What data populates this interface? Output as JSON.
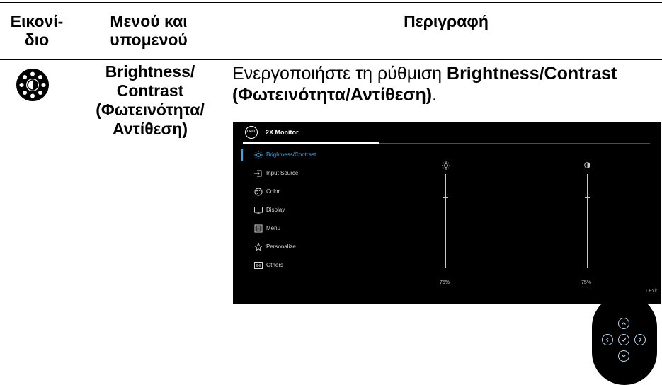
{
  "table": {
    "header": {
      "col1": [
        "Εικονί-",
        "διο"
      ],
      "col2": [
        "Μενού και",
        "υπομενού"
      ],
      "col3": "Περιγραφή"
    },
    "row": {
      "icon": "brightness-sun-icon",
      "menu_name": [
        "Brightness/",
        "Contrast",
        "(Φωτεινότητα/",
        "Αντίθεση)"
      ],
      "description": {
        "prefix": "Ενεργοποιήστε τη ρύθμιση ",
        "bold": "Brightness/Contrast (Φωτεινότητα/Αντίθεση)",
        "suffix": "."
      }
    }
  },
  "osd": {
    "logo": "DELL",
    "title": "2X Monitor",
    "menu": [
      {
        "label": "Brightness/Contrast",
        "icon": "brightness-icon",
        "active": true
      },
      {
        "label": "Input Source",
        "icon": "input-source-icon"
      },
      {
        "label": "Color",
        "icon": "color-palette-icon"
      },
      {
        "label": "Display",
        "icon": "display-icon"
      },
      {
        "label": "Menu",
        "icon": "menu-icon"
      },
      {
        "label": "Personalize",
        "icon": "star-icon"
      },
      {
        "label": "Others",
        "icon": "others-icon"
      }
    ],
    "brightness": {
      "icon": "sun-icon",
      "value_label": "75%",
      "level": 0.75
    },
    "contrast": {
      "icon": "contrast-icon",
      "value_label": "75%",
      "level": 0.75
    },
    "exit_label": "Exit"
  },
  "joystick": {
    "buttons": [
      "up",
      "left",
      "select",
      "right",
      "down"
    ]
  },
  "colors": {
    "accent": "#3ea4e7",
    "osd_background": "#000000"
  }
}
